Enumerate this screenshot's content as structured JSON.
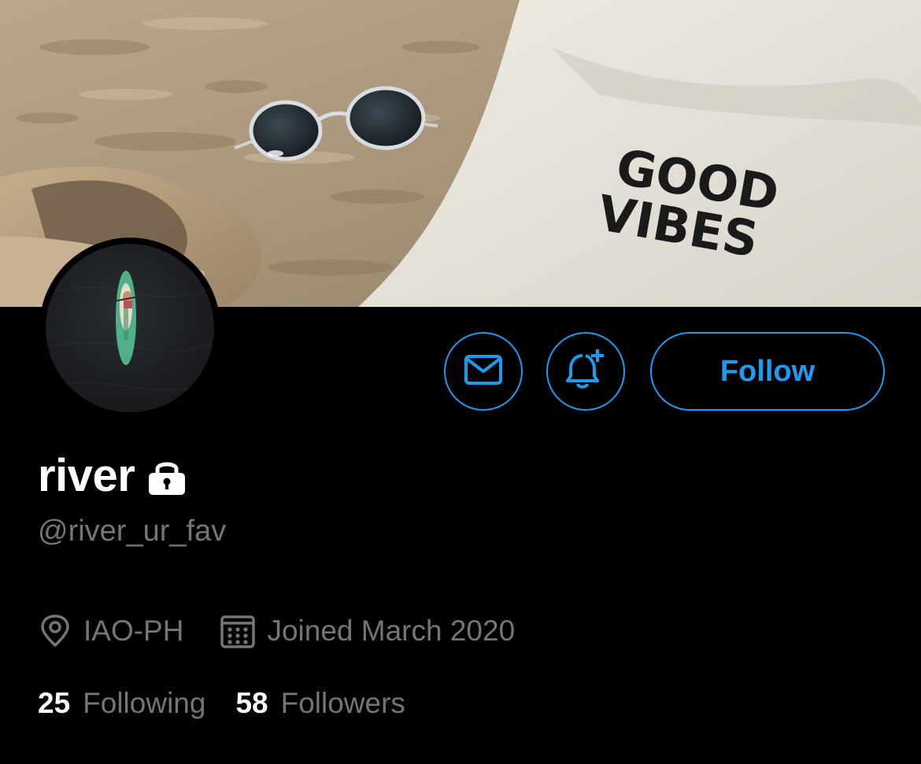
{
  "profile": {
    "display_name": "river",
    "handle": "@river_ur_fav",
    "location": "IAO-PH",
    "joined": "Joined March 2020",
    "protected": true
  },
  "banner": {
    "description_icon": "beach-photo",
    "bag_text_line1": "GOOD",
    "bag_text_line2": "VIBES"
  },
  "actions": {
    "message_icon": "envelope-icon",
    "notify_icon": "bell-plus-icon",
    "follow_label": "Follow"
  },
  "stats": {
    "following_count": "25",
    "following_label": "Following",
    "followers_count": "58",
    "followers_label": "Followers"
  },
  "colors": {
    "accent": "#1d9bf0",
    "background": "#000000",
    "primary_text": "#ffffff",
    "secondary_text": "#71767b"
  }
}
